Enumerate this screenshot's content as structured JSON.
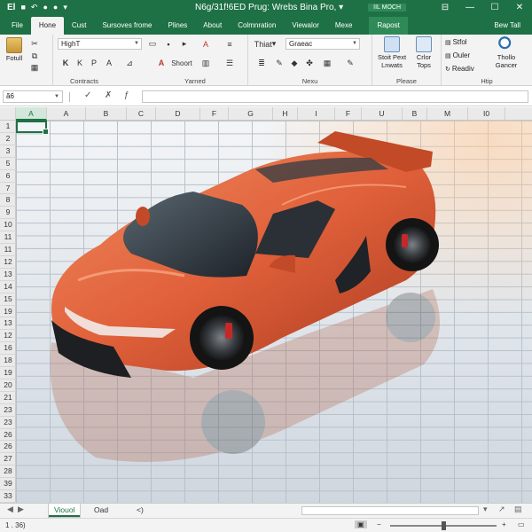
{
  "app": {
    "logo": "El",
    "title": "N6g/31f!6ED  Prug: Wrebs Bina Pro,  ▾",
    "badge": "IIL MOCH"
  },
  "tabs": [
    {
      "label": "File"
    },
    {
      "label": "Hone"
    },
    {
      "label": "Cust"
    },
    {
      "label": "Sursoves frome"
    },
    {
      "label": "Plines"
    },
    {
      "label": "About"
    },
    {
      "label": "Colmnration"
    },
    {
      "label": "Viewalor"
    },
    {
      "label": "Mexe"
    },
    {
      "label": "Rapost"
    },
    {
      "label": "Bew Tall"
    }
  ],
  "ribbon": {
    "clipboard": {
      "paste_label": "Fotull",
      "group_label": "Contracts"
    },
    "font": {
      "name": "HighT",
      "group_label": "Yarned",
      "format_label": "Shoort"
    },
    "number": {
      "style": "Thiat",
      "format": "Graeac",
      "group_label": "Nexu"
    },
    "please": {
      "btn1": "Stoit Pext\nLnwats",
      "btn2": "Crlor\nTops",
      "group_label": "Please"
    },
    "help": {
      "items": [
        "Stfol",
        "Ouler",
        "Readiv"
      ],
      "btn": "Thollo\nGancer",
      "group_label": "Htip"
    }
  },
  "formula_bar": {
    "name_box": "ã6",
    "formula": ""
  },
  "columns": [
    "A",
    "A",
    "B",
    "C",
    "D",
    "F",
    "G",
    "H",
    "I",
    "F",
    "U",
    "B",
    "M",
    "I0"
  ],
  "rows": [
    "1",
    "2",
    "3",
    "5",
    "6",
    "7",
    "8",
    "9",
    "10",
    "11",
    "11",
    "12",
    "13",
    "14",
    "15",
    "19",
    "13",
    "12",
    "16",
    "18",
    "19",
    "20",
    "21",
    "23",
    "23",
    "26",
    "26",
    "27",
    "28",
    "39",
    "33"
  ],
  "sheets": {
    "tabs": [
      "Viouol",
      "Oad",
      "<)"
    ],
    "active": "Viouol"
  },
  "status": {
    "left": "1 . 36)"
  },
  "colors": {
    "accent": "#1e7145"
  }
}
